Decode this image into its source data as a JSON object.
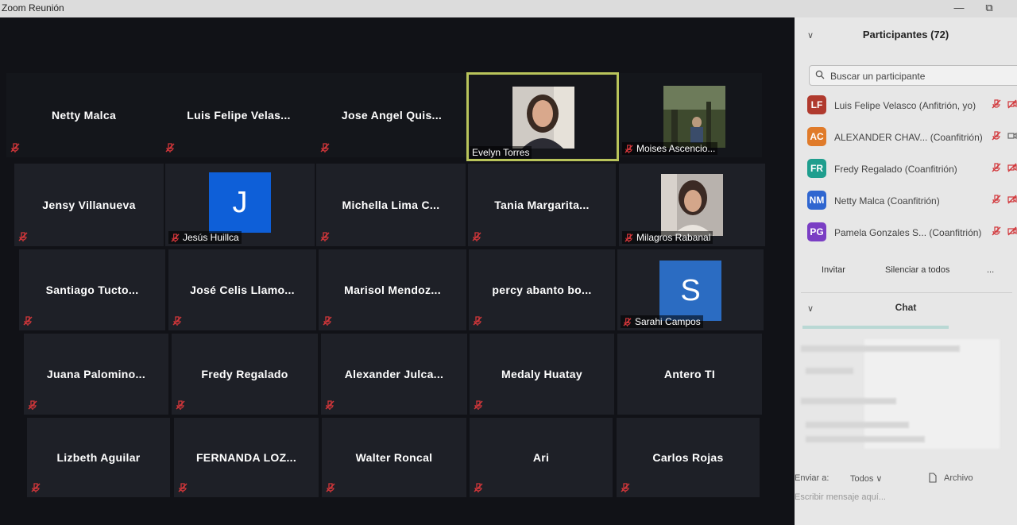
{
  "window": {
    "title": "Zoom Reunión",
    "minimize": "—",
    "restore": "⧉"
  },
  "tiles": [
    [
      "Netty Malca",
      "Luis Felipe Velas...",
      "Jose Angel Quis...",
      "Evelyn Torres",
      "Moises Ascencio..."
    ],
    [
      "Jensy Villanueva",
      "Jesús Huillca",
      "Michella Lima C...",
      "Tania  Margarita...",
      "Milagros Rabanal"
    ],
    [
      "Santiago  Tucto...",
      "José Celis Llamo...",
      "Marisol  Mendoz...",
      "percy  abanto  bo...",
      "Sarahi Campos"
    ],
    [
      "Juana  Palomino...",
      "Fredy Regalado",
      "Alexander  Julca...",
      "Medaly Huatay",
      "Antero TI"
    ],
    [
      "Lizbeth Aguilar",
      "FERNANDA LOZ...",
      "Walter Roncal",
      "Ari",
      "Carlos Rojas"
    ]
  ],
  "avatars": {
    "jesus": "J",
    "sarahi": "S"
  },
  "colors": {
    "accent": "#b9c45b",
    "mic_muted": "#d2363a",
    "avatar_blue": "#0e5fd8",
    "avatar_blue2": "#2b6cc2"
  },
  "participants": {
    "header": "Participantes (72)",
    "search_placeholder": "Buscar un participante",
    "list": [
      {
        "initials": "LF",
        "name": "Luis Felipe Velasco (Anfitrión, yo)",
        "color": "#b03a2e"
      },
      {
        "initials": "AC",
        "name": "ALEXANDER CHAV...  (Coanfitrión)",
        "color": "#e07b2a"
      },
      {
        "initials": "FR",
        "name": "Fredy Regalado (Coanfitrión)",
        "color": "#1f9e8e"
      },
      {
        "initials": "NM",
        "name": "Netty Malca (Coanfitrión)",
        "color": "#2f66d0"
      },
      {
        "initials": "PG",
        "name": "Pamela Gonzales S... (Coanfitrión)",
        "color": "#7a3ec4"
      }
    ],
    "invite": "Invitar",
    "mute_all": "Silenciar a todos",
    "more": "..."
  },
  "chat": {
    "header": "Chat",
    "send_to_label": "Enviar a:",
    "send_to_value": "Todos",
    "file": "Archivo",
    "message_placeholder": "Escribir mensaje aquí..."
  }
}
